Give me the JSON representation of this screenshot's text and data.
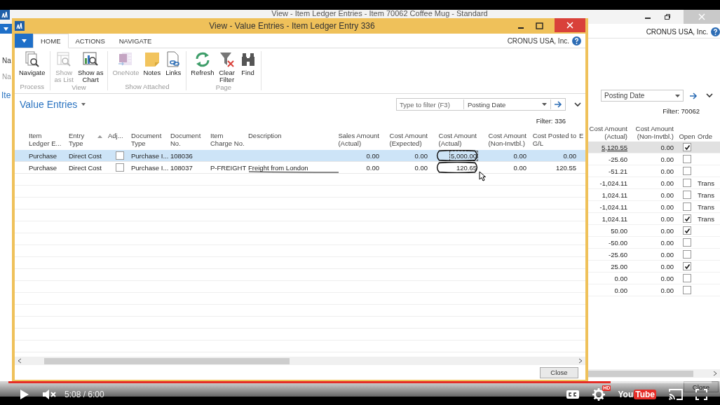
{
  "background_window": {
    "title": "View - Item Ledger Entries - Item 70062 Coffee Mug - Standard",
    "company": "CRONUS USA, Inc.",
    "side_labels": [
      "Na",
      "Na"
    ],
    "section_title": "Ite",
    "filter": {
      "field": "Posting Date"
    },
    "filter_text": "Filter: 70062",
    "columns": [
      {
        "label": "Cost Amount\n(Actual)",
        "kind": "number"
      },
      {
        "label": "Cost Amount\n(Non-Invtbl.)",
        "kind": "number"
      },
      {
        "label": "Open",
        "kind": "check"
      },
      {
        "label": "Orde",
        "kind": "text"
      }
    ],
    "rows": [
      {
        "selected": true,
        "cells": [
          {
            "text": "5,120.55"
          },
          {
            "text": "0.00"
          },
          {
            "checked": true
          }
        ]
      },
      {
        "selected": false,
        "cells": [
          {
            "text": "-25.60"
          },
          {
            "text": "0.00"
          },
          {
            "checked": false
          }
        ]
      },
      {
        "selected": false,
        "cells": [
          {
            "text": "-51.21"
          },
          {
            "text": "0.00"
          },
          {
            "checked": false
          }
        ]
      },
      {
        "selected": false,
        "cells": [
          {
            "text": "-1,024.11"
          },
          {
            "text": "0.00"
          },
          {
            "checked": false
          },
          {
            "text": "Trans"
          }
        ]
      },
      {
        "selected": false,
        "cells": [
          {
            "text": "1,024.11"
          },
          {
            "text": "0.00"
          },
          {
            "checked": false
          },
          {
            "text": "Trans"
          }
        ]
      },
      {
        "selected": false,
        "cells": [
          {
            "text": "-1,024.11"
          },
          {
            "text": "0.00"
          },
          {
            "checked": false
          },
          {
            "text": "Trans"
          }
        ]
      },
      {
        "selected": false,
        "cells": [
          {
            "text": "1,024.11"
          },
          {
            "text": "0.00"
          },
          {
            "checked": true
          },
          {
            "text": "Trans"
          }
        ]
      },
      {
        "selected": false,
        "cells": [
          {
            "text": "50.00"
          },
          {
            "text": "0.00"
          },
          {
            "checked": true
          }
        ]
      },
      {
        "selected": false,
        "cells": [
          {
            "text": "-50.00"
          },
          {
            "text": "0.00"
          },
          {
            "checked": false
          }
        ]
      },
      {
        "selected": false,
        "cells": [
          {
            "text": "-25.60"
          },
          {
            "text": "0.00"
          },
          {
            "checked": false
          }
        ]
      },
      {
        "selected": false,
        "cells": [
          {
            "text": "25.00"
          },
          {
            "text": "0.00"
          },
          {
            "checked": true
          }
        ]
      },
      {
        "selected": false,
        "cells": [
          {
            "text": "0.00"
          },
          {
            "text": "0.00"
          },
          {
            "checked": false
          }
        ]
      },
      {
        "selected": false,
        "cells": [
          {
            "text": "0.00"
          },
          {
            "text": "0.00"
          },
          {
            "checked": false
          }
        ]
      }
    ],
    "close_button": "Close"
  },
  "dialog": {
    "title": "View - Value Entries - Item Ledger Entry 336",
    "tabs": [
      {
        "label": "HOME",
        "selected": true
      },
      {
        "label": "ACTIONS",
        "selected": false
      },
      {
        "label": "NAVIGATE",
        "selected": false
      }
    ],
    "company": "CRONUS USA, Inc.",
    "ribbon": [
      {
        "label": "Process",
        "buttons": [
          {
            "label": "Navigate",
            "disabled": false
          }
        ]
      },
      {
        "label": "View",
        "buttons": [
          {
            "label": "Show\nas List",
            "disabled": true
          },
          {
            "label": "Show as\nChart",
            "disabled": false
          }
        ]
      },
      {
        "label": "Show Attached",
        "buttons": [
          {
            "label": "OneNote",
            "disabled": true
          },
          {
            "label": "Notes",
            "disabled": false
          },
          {
            "label": "Links",
            "disabled": false
          }
        ]
      },
      {
        "label": "Page",
        "buttons": [
          {
            "label": "Refresh",
            "disabled": false
          },
          {
            "label": "Clear\nFilter",
            "disabled": false
          },
          {
            "label": "Find",
            "disabled": false
          }
        ]
      }
    ],
    "page_title": "Value Entries",
    "filter": {
      "placeholder": "Type to filter (F3)",
      "field": "Posting Date"
    },
    "filter_text": "Filter: 336",
    "columns": [
      {
        "label": "Item\nLedger E...",
        "kind": "text"
      },
      {
        "label": "Entry\nType",
        "kind": "text",
        "sorted": true
      },
      {
        "label": "Adj...",
        "kind": "check"
      },
      {
        "label": "Document\nType",
        "kind": "text"
      },
      {
        "label": "Document\nNo.",
        "kind": "text"
      },
      {
        "label": "Item\nCharge No.",
        "kind": "text"
      },
      {
        "label": "Description",
        "kind": "text"
      },
      {
        "label": "Sales Amount\n(Actual)",
        "kind": "number"
      },
      {
        "label": "Cost Amount\n(Expected)",
        "kind": "number"
      },
      {
        "label": "Cost Amount\n(Actual)",
        "kind": "number"
      },
      {
        "label": "Cost Amount\n(Non-Invtbl.)",
        "kind": "number"
      },
      {
        "label": "Cost Posted to\nG/L",
        "kind": "number"
      },
      {
        "label": "E",
        "kind": "text"
      }
    ],
    "rows": [
      {
        "selected": true,
        "cells": [
          {
            "text": "Purchase"
          },
          {
            "text": "Direct Cost"
          },
          {
            "checked": false
          },
          {
            "text": "Purchase I..."
          },
          {
            "text": "108036"
          },
          null,
          null,
          {
            "text": "0.00"
          },
          {
            "text": "0.00"
          },
          {
            "text": "5,000.00",
            "focused": true,
            "circled": true
          },
          {
            "text": "0.00"
          },
          {
            "text": "0.00"
          }
        ]
      },
      {
        "selected": false,
        "cells": [
          {
            "text": "Purchase"
          },
          {
            "text": "Direct Cost"
          },
          {
            "checked": false
          },
          {
            "text": "Purchase I..."
          },
          {
            "text": "108037"
          },
          {
            "text": "P-FREIGHT"
          },
          {
            "text": "Freight from London",
            "underlined": true
          },
          {
            "text": "0.00"
          },
          {
            "text": "0.00"
          },
          {
            "text": "120.65",
            "circled": true
          },
          {
            "text": "0.00"
          },
          {
            "text": "120.55"
          }
        ]
      }
    ],
    "close_button": "Close"
  },
  "video_player": {
    "paused": true,
    "muted": true,
    "time": "5:08 / 6:00",
    "level": 0.856,
    "hd_badge": "HD",
    "logo": {
      "left": "You",
      "right": "Tube"
    }
  }
}
